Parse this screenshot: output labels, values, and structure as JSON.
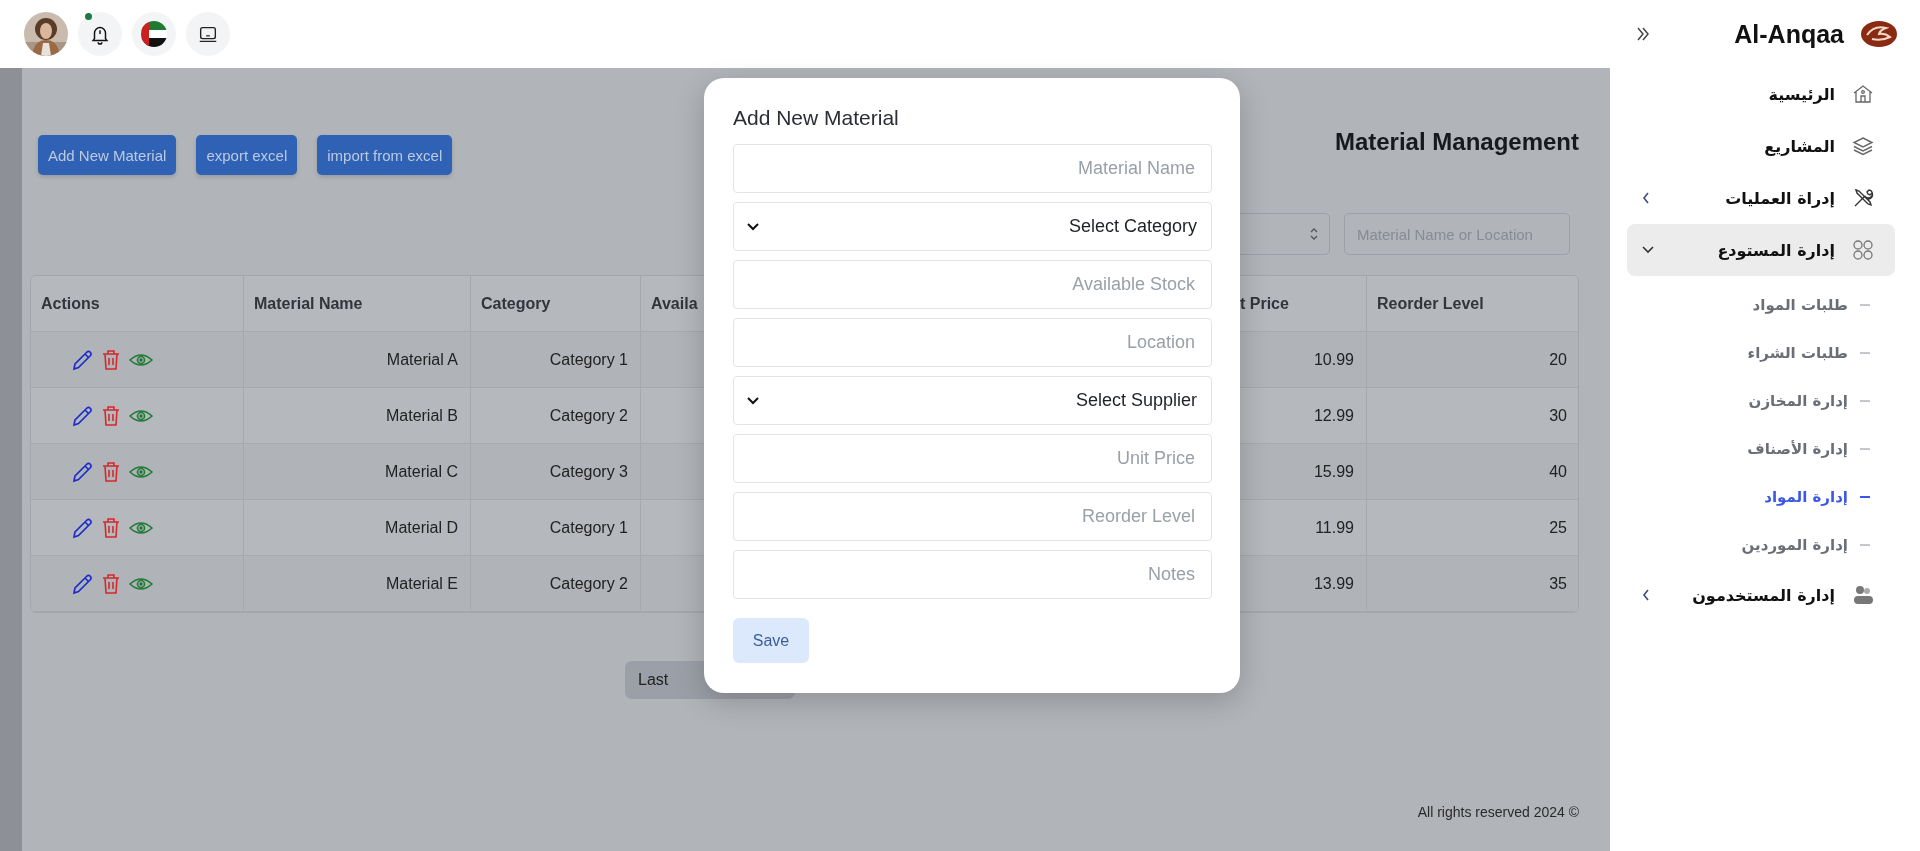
{
  "header": {
    "notification_unread": true
  },
  "sidebar": {
    "brand": "Al-Anqaa",
    "items": [
      {
        "label": "الرئيسية",
        "selected": false
      },
      {
        "label": "المشاريع",
        "selected": false
      },
      {
        "label": "إدراة العمليات",
        "selected": false,
        "expanded": false
      },
      {
        "label": "إدارة المستودع",
        "selected": true,
        "expanded": true,
        "children": [
          {
            "label": "طلبات المواد",
            "selected": false
          },
          {
            "label": "طلبات الشراء",
            "selected": false
          },
          {
            "label": "إدارة المخازن",
            "selected": false
          },
          {
            "label": "إدارة الأصناف",
            "selected": false
          },
          {
            "label": "إدارة المواد",
            "selected": true
          },
          {
            "label": "إدارة الموردين",
            "selected": false
          }
        ]
      },
      {
        "label": "إدارة المستخدمون",
        "selected": false,
        "expanded": false
      }
    ]
  },
  "page": {
    "title": "Material Management",
    "actions": [
      "Add New Material",
      "export excel",
      "import from excel"
    ],
    "search": {
      "placeholder": "Material Name or Location"
    },
    "table": {
      "columns": [
        "Actions",
        "Material Name",
        "Category",
        "Availa",
        "t Price",
        "Reorder Level"
      ],
      "rows": [
        {
          "material_name": "Material A",
          "category": "Category 1",
          "price": "10.99",
          "reorder_level": "20"
        },
        {
          "material_name": "Material B",
          "category": "Category 2",
          "price": "12.99",
          "reorder_level": "30"
        },
        {
          "material_name": "Material C",
          "category": "Category 3",
          "price": "15.99",
          "reorder_level": "40"
        },
        {
          "material_name": "Material D",
          "category": "Category 1",
          "price": "11.99",
          "reorder_level": "25"
        },
        {
          "material_name": "Material E",
          "category": "Category 2",
          "price": "13.99",
          "reorder_level": "35"
        }
      ]
    },
    "pagination": [
      "Last"
    ],
    "footer": "All rights reserved 2024 ©"
  },
  "modal": {
    "title": "Add New Material",
    "fields": [
      {
        "kind": "input",
        "placeholder": "Material Name"
      },
      {
        "kind": "select",
        "value": "Select Category"
      },
      {
        "kind": "input",
        "placeholder": "Available Stock"
      },
      {
        "kind": "input",
        "placeholder": "Location"
      },
      {
        "kind": "select",
        "value": "Select Supplier"
      },
      {
        "kind": "input",
        "placeholder": "Unit Price"
      },
      {
        "kind": "input",
        "placeholder": "Reorder Level"
      },
      {
        "kind": "input",
        "placeholder": "Notes"
      }
    ],
    "save": "Save"
  }
}
